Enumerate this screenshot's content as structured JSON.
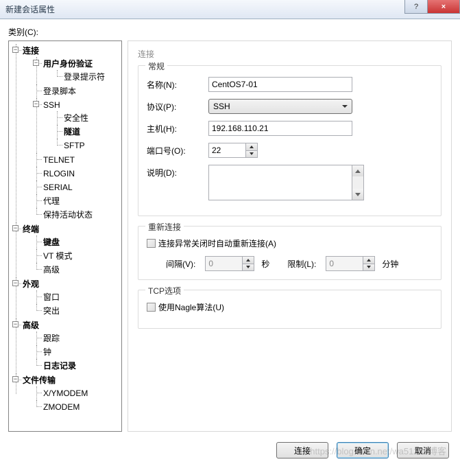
{
  "window": {
    "title": "新建会话属性",
    "help_btn": "?",
    "close_btn": "×"
  },
  "category_label": "类别(C):",
  "tree": {
    "connection": "连接",
    "auth": "用户身份验证",
    "login_prompt": "登录提示符",
    "login_script": "登录脚本",
    "ssh": "SSH",
    "security": "安全性",
    "tunnel": "隧道",
    "sftp": "SFTP",
    "telnet": "TELNET",
    "rlogin": "RLOGIN",
    "serial": "SERIAL",
    "proxy": "代理",
    "keepalive": "保持活动状态",
    "terminal": "终端",
    "keyboard": "键盘",
    "vtmode": "VT 模式",
    "advanced_term": "高级",
    "appearance": "外观",
    "window": "窗口",
    "highlight": "突出",
    "advanced": "高级",
    "trace": "跟踪",
    "bell": "钟",
    "logging": "日志记录",
    "filetransfer": "文件传输",
    "xymodem": "X/YMODEM",
    "zmodem": "ZMODEM"
  },
  "right": {
    "heading": "连接",
    "general": "常规",
    "name_label": "名称(N):",
    "name_value": "CentOS7-01",
    "protocol_label": "协议(P):",
    "protocol_value": "SSH",
    "host_label": "主机(H):",
    "host_value": "192.168.110.21",
    "port_label": "端口号(O):",
    "port_value": "22",
    "desc_label": "说明(D):",
    "reconnect": "重新连接",
    "reconnect_check": "连接异常关闭时自动重新连接(A)",
    "interval_label": "间隔(V):",
    "interval_value": "0",
    "seconds": "秒",
    "limit_label": "限制(L):",
    "limit_value": "0",
    "minutes": "分钟",
    "tcp": "TCP选项",
    "nagle": "使用Nagle算法(U)"
  },
  "buttons": {
    "connect": "连接",
    "ok": "确定",
    "cancel": "取消"
  },
  "watermark": "https://blog.csdn.net/wa51280博客"
}
